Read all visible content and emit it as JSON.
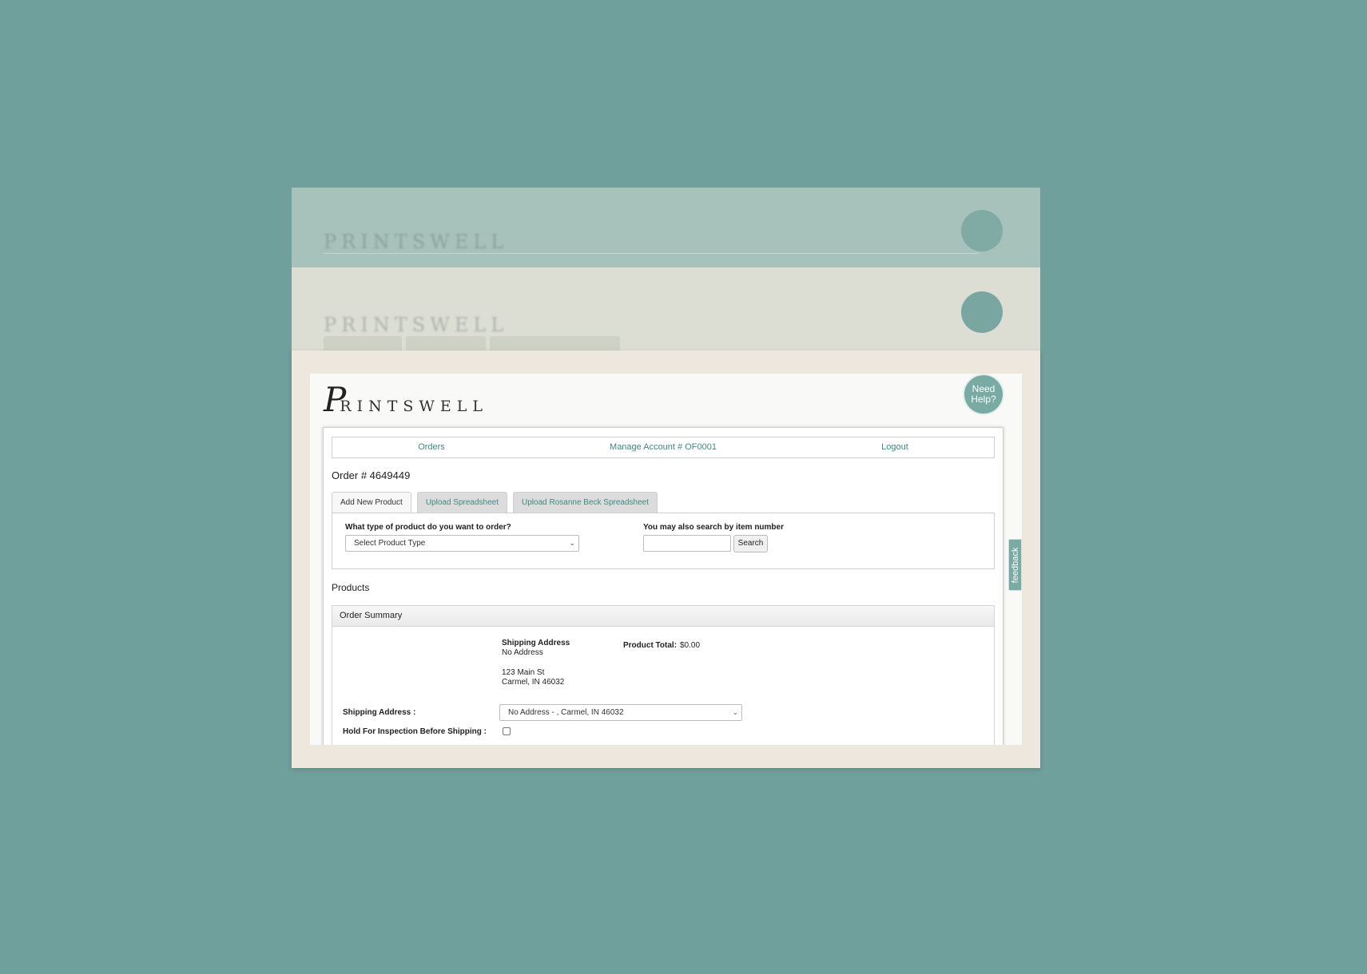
{
  "brand": {
    "logo_initial": "P",
    "logo_rest": "RINTSWELL"
  },
  "help": {
    "label": "Need Help?"
  },
  "nav": {
    "orders": "Orders",
    "account": "Manage Account # OF0001",
    "logout": "Logout"
  },
  "order": {
    "title": "Order # 4649449"
  },
  "tabs": [
    {
      "label": "Add New Product"
    },
    {
      "label": "Upload Spreadsheet"
    },
    {
      "label": "Upload Rosanne Beck Spreadsheet"
    }
  ],
  "add_product": {
    "type_label": "What type of product do you want to order?",
    "type_value": "Select Product Type",
    "search_label": "You may also search by item number",
    "search_value": "",
    "search_button": "Search"
  },
  "products": {
    "title": "Products"
  },
  "summary": {
    "title": "Order Summary",
    "ship_heading": "Shipping Address",
    "ship_line1": "No Address",
    "ship_line2": "123 Main St",
    "ship_line3": "Carmel, IN 46032",
    "total_label": "Product Total:",
    "total_value": "$0.00",
    "ship_field_label": "Shipping Address :",
    "ship_field_value": "No Address - , Carmel, IN 46032",
    "hold_label": "Hold For Inspection Before Shipping :",
    "hold_checked": false
  },
  "feedback": {
    "label": "feedback"
  },
  "colors": {
    "background": "#6fa09b",
    "accent": "#3d8a80",
    "frame": "#ede7dd",
    "help_bubble": "#79aaa3"
  }
}
